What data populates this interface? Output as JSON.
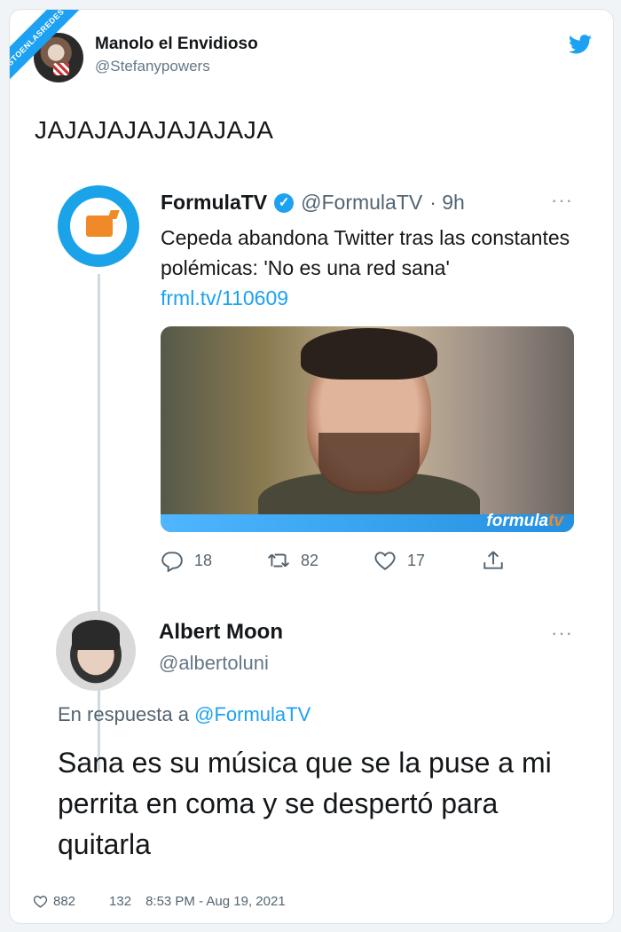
{
  "watermark": "VISTOENLASREDES .com",
  "tweet": {
    "author_name": "Manolo el Envidioso",
    "author_handle": "@Stefanypowers",
    "text": "JAJAJAJAJAJAJAJA",
    "likes": "882",
    "retweets": "132",
    "timestamp": "8:53 PM - Aug 19, 2021"
  },
  "quoted": {
    "author_name": "FormulaTV",
    "author_handle": "@FormulaTV",
    "time": "· 9h",
    "text": "Cepeda abandona Twitter tras las constantes polémicas: 'No es una red sana'",
    "link": "frml.tv/110609",
    "image_brand_a": "formula",
    "image_brand_b": "tv",
    "replies": "18",
    "retweets": "82",
    "likes": "17",
    "more": "···"
  },
  "reply": {
    "author_name": "Albert Moon",
    "author_handle": "@albertoluni",
    "in_reply_prefix": "En respuesta a",
    "in_reply_to": "@FormulaTV",
    "text": "Sana es su música que se la puse a mi perrita en coma y se despertó para quitarla",
    "more": "···"
  },
  "colors": {
    "accent": "#1da1f2",
    "text": "#14171a",
    "muted": "#536471"
  }
}
